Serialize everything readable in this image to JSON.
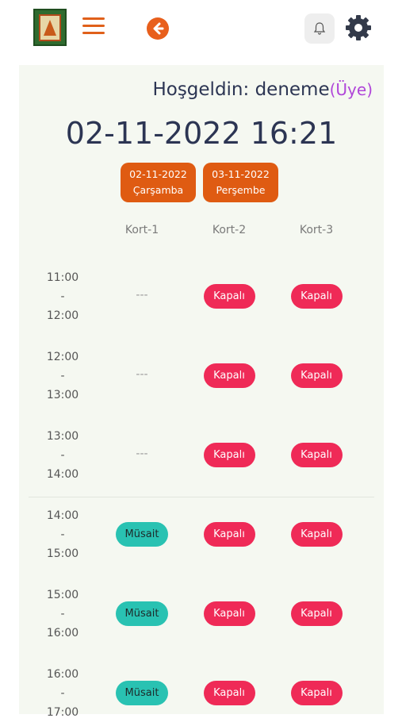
{
  "header": {
    "logo_icon": "club-logo",
    "menu_icon": "hamburger-menu-icon",
    "back_icon": "arrow-left-circle-icon",
    "bell_icon": "bell-icon",
    "settings_icon": "gear-icon",
    "accent_color": "#e0601a"
  },
  "welcome": {
    "label": "Hoşgeldin: deneme",
    "role": "(Üye)"
  },
  "datetime": "02-11-2022 16:21",
  "days": [
    {
      "date": "02-11-2022",
      "day": "Çarşamba"
    },
    {
      "date": "03-11-2022",
      "day": "Perşembe"
    }
  ],
  "courts": [
    "Kort-1",
    "Kort-2",
    "Kort-3"
  ],
  "rows": [
    {
      "start": "11:00",
      "sep": "-",
      "end": "12:00",
      "slots": [
        "---",
        "Kapalı",
        "Kapalı"
      ]
    },
    {
      "start": "12:00",
      "sep": "-",
      "end": "13:00",
      "slots": [
        "---",
        "Kapalı",
        "Kapalı"
      ]
    },
    {
      "start": "13:00",
      "sep": "-",
      "end": "14:00",
      "slots": [
        "---",
        "Kapalı",
        "Kapalı"
      ]
    },
    {
      "start": "14:00",
      "sep": "-",
      "end": "15:00",
      "slots": [
        "Müsait",
        "Kapalı",
        "Kapalı"
      ]
    },
    {
      "start": "15:00",
      "sep": "-",
      "end": "16:00",
      "slots": [
        "Müsait",
        "Kapalı",
        "Kapalı"
      ]
    },
    {
      "start": "16:00",
      "sep": "-",
      "end": "17:00",
      "slots": [
        "Müsait",
        "Kapalı",
        "Kapalı"
      ]
    }
  ],
  "status_colors": {
    "Kapalı": "#ef2a57",
    "Müsait": "#29c2b2"
  }
}
